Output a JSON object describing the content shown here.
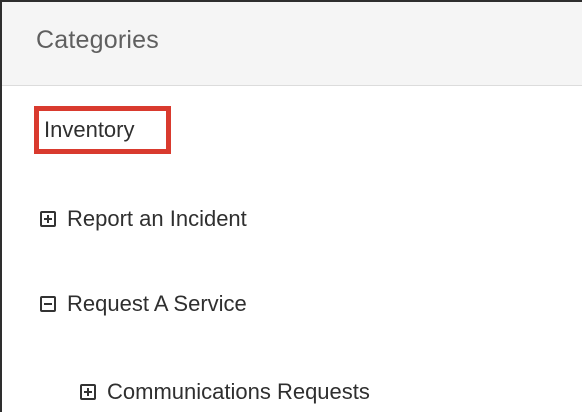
{
  "panel": {
    "title": "Categories"
  },
  "tree": {
    "highlighted_item": "Inventory",
    "items": [
      {
        "label": "Report an Incident",
        "toggle": "plus-box-icon"
      },
      {
        "label": "Request A Service",
        "toggle": "minus-box-icon"
      },
      {
        "label": "Communications Requests",
        "toggle": "plus-box-icon"
      }
    ]
  },
  "colors": {
    "highlight_border": "#d93a2e",
    "header_background": "#f5f5f5",
    "text": "#2f2f2f"
  }
}
